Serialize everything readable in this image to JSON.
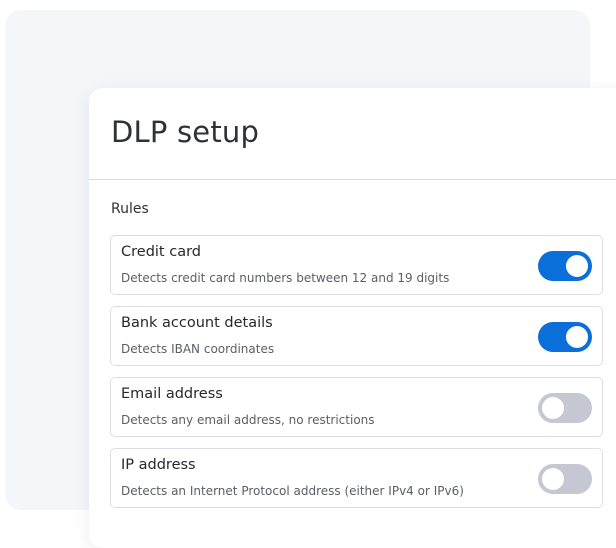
{
  "panel": {
    "title": "DLP setup",
    "section_label": "Rules"
  },
  "rules": [
    {
      "name": "Credit card",
      "description": "Detects credit card numbers between 12 and 19 digits",
      "enabled": true
    },
    {
      "name": "Bank account details",
      "description": "Detects IBAN coordinates",
      "enabled": true
    },
    {
      "name": "Email address",
      "description": "Detects any email address, no restrictions",
      "enabled": false
    },
    {
      "name": "IP address",
      "description": "Detects an Internet Protocol address (either IPv4 or IPv6)",
      "enabled": false
    }
  ],
  "colors": {
    "toggle_on": "#0a6fd8",
    "toggle_off": "#c5c7d3",
    "background_panel": "#f4f6fa"
  }
}
